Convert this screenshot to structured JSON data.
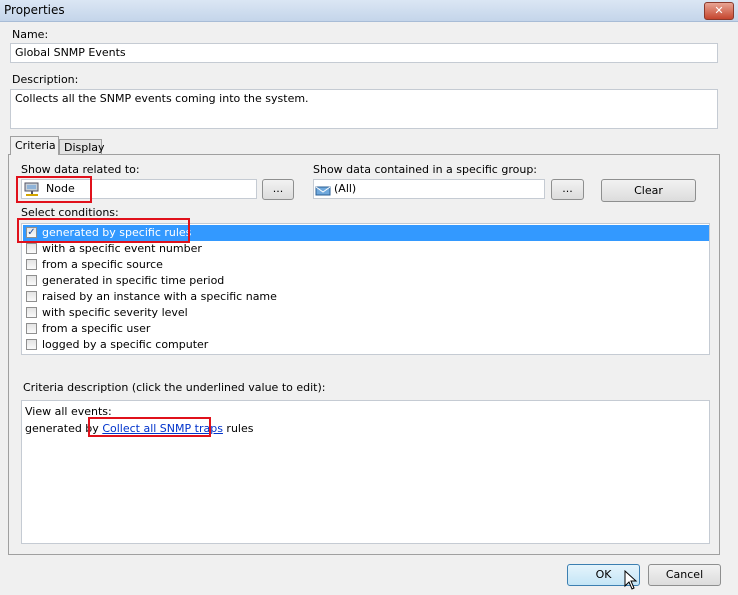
{
  "window": {
    "title": "Properties",
    "close_icon": "close-icon"
  },
  "name": {
    "label": "Name:",
    "value": "Global SNMP Events"
  },
  "description": {
    "label": "Description:",
    "value": "Collects all the SNMP events coming into the system."
  },
  "tabs": [
    {
      "label": "Criteria",
      "active": true
    },
    {
      "label": "Display",
      "active": false
    }
  ],
  "criteria": {
    "related_label": "Show data related to:",
    "related_value": "Node",
    "related_icon": "server-node-icon",
    "browse_label": "...",
    "group_label": "Show data contained in a specific group:",
    "group_value": "(All)",
    "group_icon": "group-envelope-icon",
    "clear_label": "Clear",
    "conditions_label": "Select conditions:",
    "conditions": [
      {
        "label": "generated by specific rules",
        "checked": true,
        "selected": true
      },
      {
        "label": "with a specific event number",
        "checked": false
      },
      {
        "label": "from a specific source",
        "checked": false
      },
      {
        "label": "generated in specific time period",
        "checked": false
      },
      {
        "label": "raised by an instance with a specific name",
        "checked": false
      },
      {
        "label": "with specific severity level",
        "checked": false
      },
      {
        "label": "from a specific user",
        "checked": false
      },
      {
        "label": "logged by a specific computer",
        "checked": false
      }
    ],
    "desc_label": "Criteria description (click the underlined value to edit):",
    "desc_line1": "View all events:",
    "desc_prefix": "generated by ",
    "desc_link": "Collect all SNMP traps",
    "desc_suffix": " rules"
  },
  "buttons": {
    "ok": "OK",
    "cancel": "Cancel"
  },
  "colors": {
    "selection": "#3399ff",
    "highlight": "#e0111b",
    "link": "#0033cc"
  }
}
